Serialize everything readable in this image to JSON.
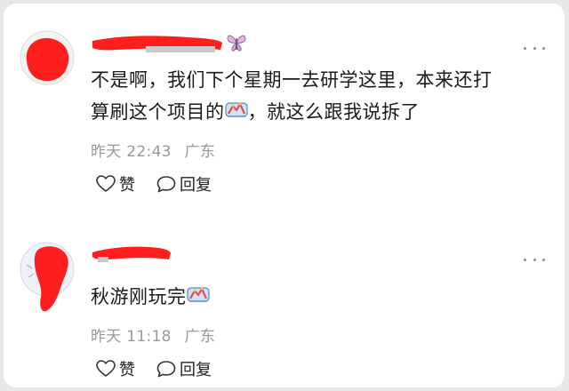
{
  "comments": [
    {
      "text_line1": "不是啊，我们下个星期一去研学这里，本来还打",
      "text_line2_before": "算刷这个项目的",
      "text_line2_after": "，就这么跟我说拆了",
      "time": "昨天 22:43",
      "location": "广东",
      "like_label": "赞",
      "reply_label": "回复",
      "inline_emoji": "amusement-ride-emoji",
      "username_emoji": "butterfly-emoji"
    },
    {
      "text_before": "秋游刚玩完",
      "time": "昨天 11:18",
      "location": "广东",
      "like_label": "赞",
      "reply_label": "回复",
      "inline_emoji": "amusement-ride-emoji"
    }
  ],
  "colors": {
    "redaction": "#ff1e1e",
    "meta_text": "#999999",
    "body_text": "#1a1a1a",
    "background": "#ffffff"
  }
}
